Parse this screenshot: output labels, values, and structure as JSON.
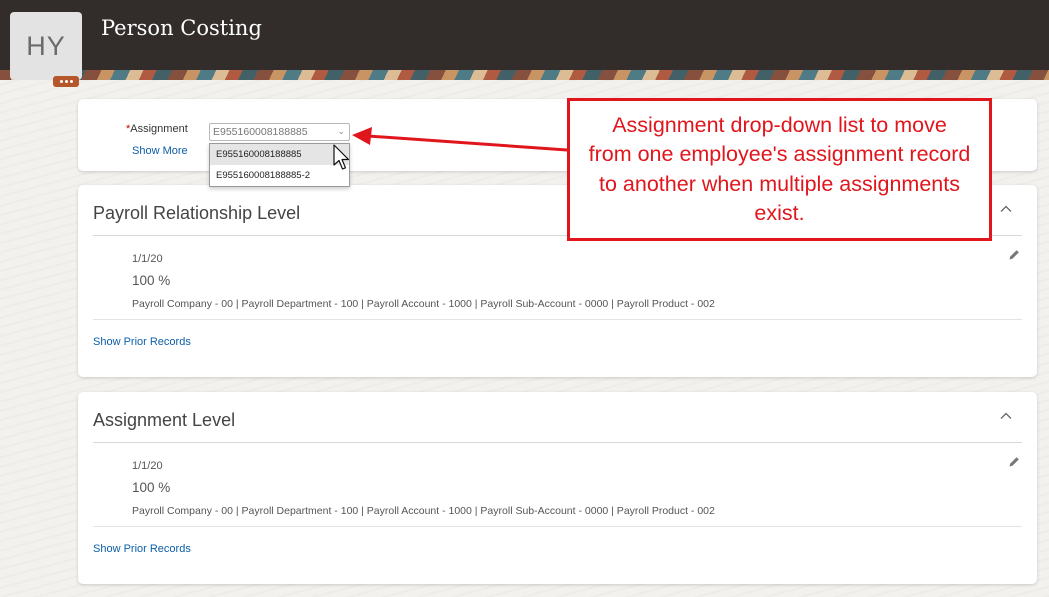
{
  "header": {
    "title": "Person Costing",
    "avatar_initials": "HY",
    "more_icon": "ellipsis-icon"
  },
  "assignment": {
    "label": "Assignment",
    "required_marker": "*",
    "selected": "E955160008188885",
    "show_more": "Show More",
    "options": [
      "E955160008188885",
      "E955160008188885-2"
    ]
  },
  "callout": {
    "text": "Assignment drop-down list to move from one employee's assignment record to another when multiple assignments exist.",
    "color": "#e0161c"
  },
  "sections": [
    {
      "title": "Payroll Relationship Level",
      "record": {
        "date": "1/1/20",
        "percent": "100 %",
        "detail": "Payroll Company - 00 | Payroll Department - 100 | Payroll Account - 1000 | Payroll Sub-Account - 0000 | Payroll Product - 002"
      },
      "prior_link": "Show Prior Records"
    },
    {
      "title": "Assignment Level",
      "record": {
        "date": "1/1/20",
        "percent": "100 %",
        "detail": "Payroll Company - 00 | Payroll Department - 100 | Payroll Account - 1000 | Payroll Sub-Account - 0000 | Payroll Product - 002"
      },
      "prior_link": "Show Prior Records"
    }
  ],
  "colors": {
    "header_bg": "#322d2a",
    "link": "#0b5ea8",
    "required": "#cc0000"
  }
}
